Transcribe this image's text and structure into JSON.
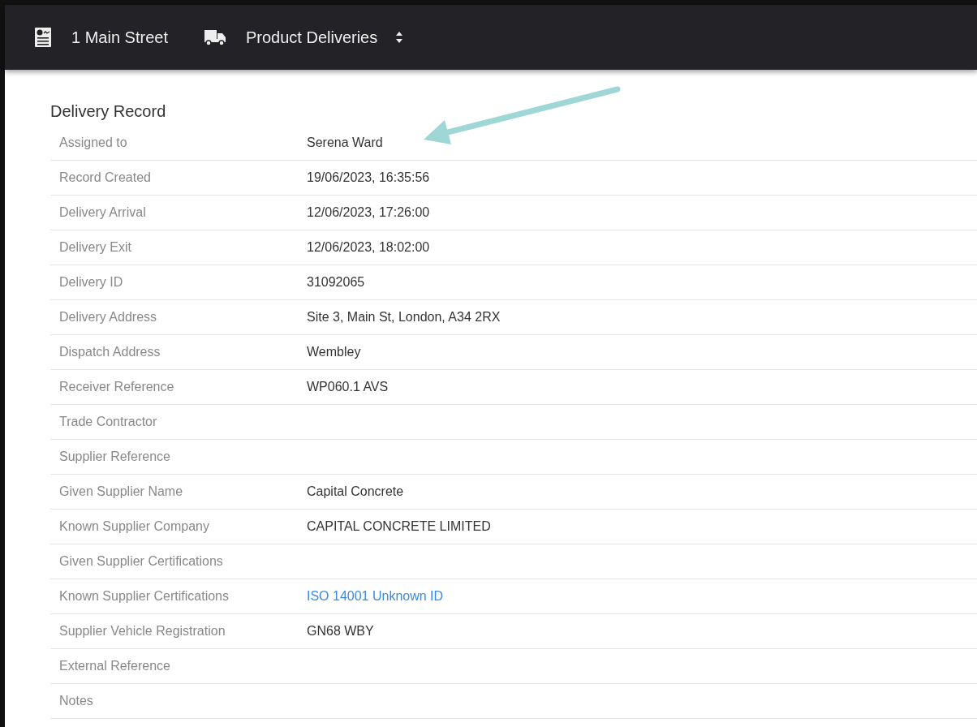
{
  "top_bar": {
    "site": "1 Main Street",
    "module": "Product Deliveries"
  },
  "record": {
    "title": "Delivery Record",
    "rows": [
      {
        "label": "Assigned to",
        "value": "Serena Ward",
        "kind": "text"
      },
      {
        "label": "Record Created",
        "value": "19/06/2023, 16:35:56",
        "kind": "text"
      },
      {
        "label": "Delivery Arrival",
        "value": "12/06/2023, 17:26:00",
        "kind": "text"
      },
      {
        "label": "Delivery Exit",
        "value": "12/06/2023, 18:02:00",
        "kind": "text"
      },
      {
        "label": "Delivery ID",
        "value": "31092065",
        "kind": "text"
      },
      {
        "label": "Delivery Address",
        "value": "Site 3, Main St, London, A34 2RX",
        "kind": "text"
      },
      {
        "label": "Dispatch Address",
        "value": "Wembley",
        "kind": "text"
      },
      {
        "label": "Receiver Reference",
        "value": "WP060.1 AVS",
        "kind": "text"
      },
      {
        "label": "Trade Contractor"
      },
      {
        "label": "Supplier Reference"
      },
      {
        "label": "Given Supplier Name",
        "value": "Capital Concrete",
        "kind": "text"
      },
      {
        "label": "Known Supplier Company",
        "value": "CAPITAL CONCRETE LIMITED",
        "kind": "text"
      },
      {
        "label": "Given Supplier Certifications"
      },
      {
        "label": "Known Supplier Certifications",
        "value": "ISO 14001 Unknown ID",
        "kind": "link"
      },
      {
        "label": "Supplier Vehicle Registration",
        "value": "GN68 WBY",
        "kind": "text"
      },
      {
        "label": "External Reference"
      },
      {
        "label": "Notes"
      }
    ]
  }
}
